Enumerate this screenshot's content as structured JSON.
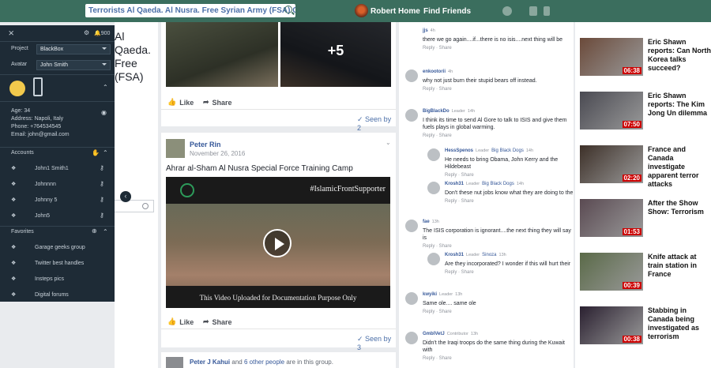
{
  "topbar": {
    "search_value": "Terrorists Al Qaeda. Al Nusra.  Free Syrian Army (FSA) C.I.A...",
    "user_name": "Robert",
    "home_label": "Home",
    "find_friends_label": "Find Friends"
  },
  "feed": {
    "post1": {
      "more_photos": "+5",
      "like_label": "Like",
      "share_label": "Share",
      "seen_label": "Seen by 2"
    },
    "post2": {
      "author": "Peter Rin",
      "date": "November 26, 2016",
      "text": "Ahrar al-Sham Al Nusra Special Force Training Camp",
      "video_watermark": "#IslamicFrontSupporter",
      "video_caption": "This Video Uploaded for Documentation Purpose Only",
      "like_label": "Like",
      "share_label": "Share",
      "seen_label": "Seen by 3"
    },
    "post3": {
      "author": "Peter J Kahui",
      "joiner": "and",
      "others_link": "6 other people",
      "suffix": "are in this group."
    }
  },
  "comments": [
    {
      "name": "jjs",
      "time": "4h",
      "text": "there we go again....if...there is no isis....next thing will be",
      "actions": "Reply · Share"
    },
    {
      "name": "enkootorii",
      "time": "4h",
      "text": "why not just burn their stupid bears off instead.",
      "actions": "Reply · Share"
    },
    {
      "name": "BigBlackDo",
      "badge": "Leader",
      "time": "14h",
      "text": "I think its time to send Al Gore to talk to ISIS and give them fuels plays in global warming.",
      "actions": "Reply · Share"
    },
    {
      "name": "HessSpenos",
      "badge": "Leader",
      "reply_to": "Big Black Dogs",
      "time": "14h",
      "text": "He needs to bring Obama, John Kerry and the Hildebeast",
      "actions": "Reply · Share"
    },
    {
      "name": "Krosh31",
      "badge": "Leader",
      "reply_to": "Big Black Dogs",
      "time": "14h",
      "text": "Don't these nut jobs know what they are doing to the",
      "actions": "Reply · Share"
    },
    {
      "name": "fae",
      "time": "13h",
      "text": "The ISIS corporation is ignorant....the next thing they will say is",
      "actions": "Reply · Share"
    },
    {
      "name": "Krosh31",
      "badge": "Leader",
      "reply_to": "Sinoza",
      "time": "13h",
      "text": "Are they incorporated? I wonder if this will hurt their",
      "actions": "Reply · Share"
    },
    {
      "name": "kwyiki",
      "badge": "Leader",
      "time": "13h",
      "text": "Same ole.... same ole",
      "actions": "Reply · Share"
    },
    {
      "name": "GmblVetJ",
      "badge": "Contributor",
      "time": "13h",
      "text": "Didn't the Iraqi troops do the same thing during the Kuwait with",
      "actions": "Reply · Share"
    }
  ],
  "news": [
    {
      "title": "Eric Shawn reports: Can North Korea talks succeed?",
      "time": "06:38"
    },
    {
      "title": "Eric Shawn reports: The Kim Jong Un dilemma",
      "time": "07:50"
    },
    {
      "title": "France and Canada investigate apparent terror attacks",
      "time": "02:20"
    },
    {
      "title": "After the Show Show: Terrorism",
      "time": "01:53"
    },
    {
      "title": "Knife attack at train station in France",
      "time": "00:39"
    },
    {
      "title": "Stabbing in Canada being investigated as terrorism",
      "time": "00:38"
    }
  ],
  "panel": {
    "notif_count": "900",
    "project_label": "Project",
    "project_value": "BlackBox",
    "avatar_label": "Avatar",
    "avatar_value": "John Smith",
    "age": "Age: 34",
    "address": "Address: Napoli, Italy",
    "phone": "Phone: +764534545",
    "email": "Email: john@gmail.com",
    "accounts_header": "Accounts",
    "accounts": [
      "John1 Smith1",
      "Johnnnn",
      "Johnny 5",
      "John5"
    ],
    "favorites_header": "Favorites",
    "favorites": [
      "Garage geeks group",
      "Twitter best handles",
      "Insteps pics",
      "Digital forums"
    ]
  },
  "behind": {
    "title_line1": "Al Qaeda.",
    "title_line2": "Free",
    "title_line3": "(FSA)"
  }
}
